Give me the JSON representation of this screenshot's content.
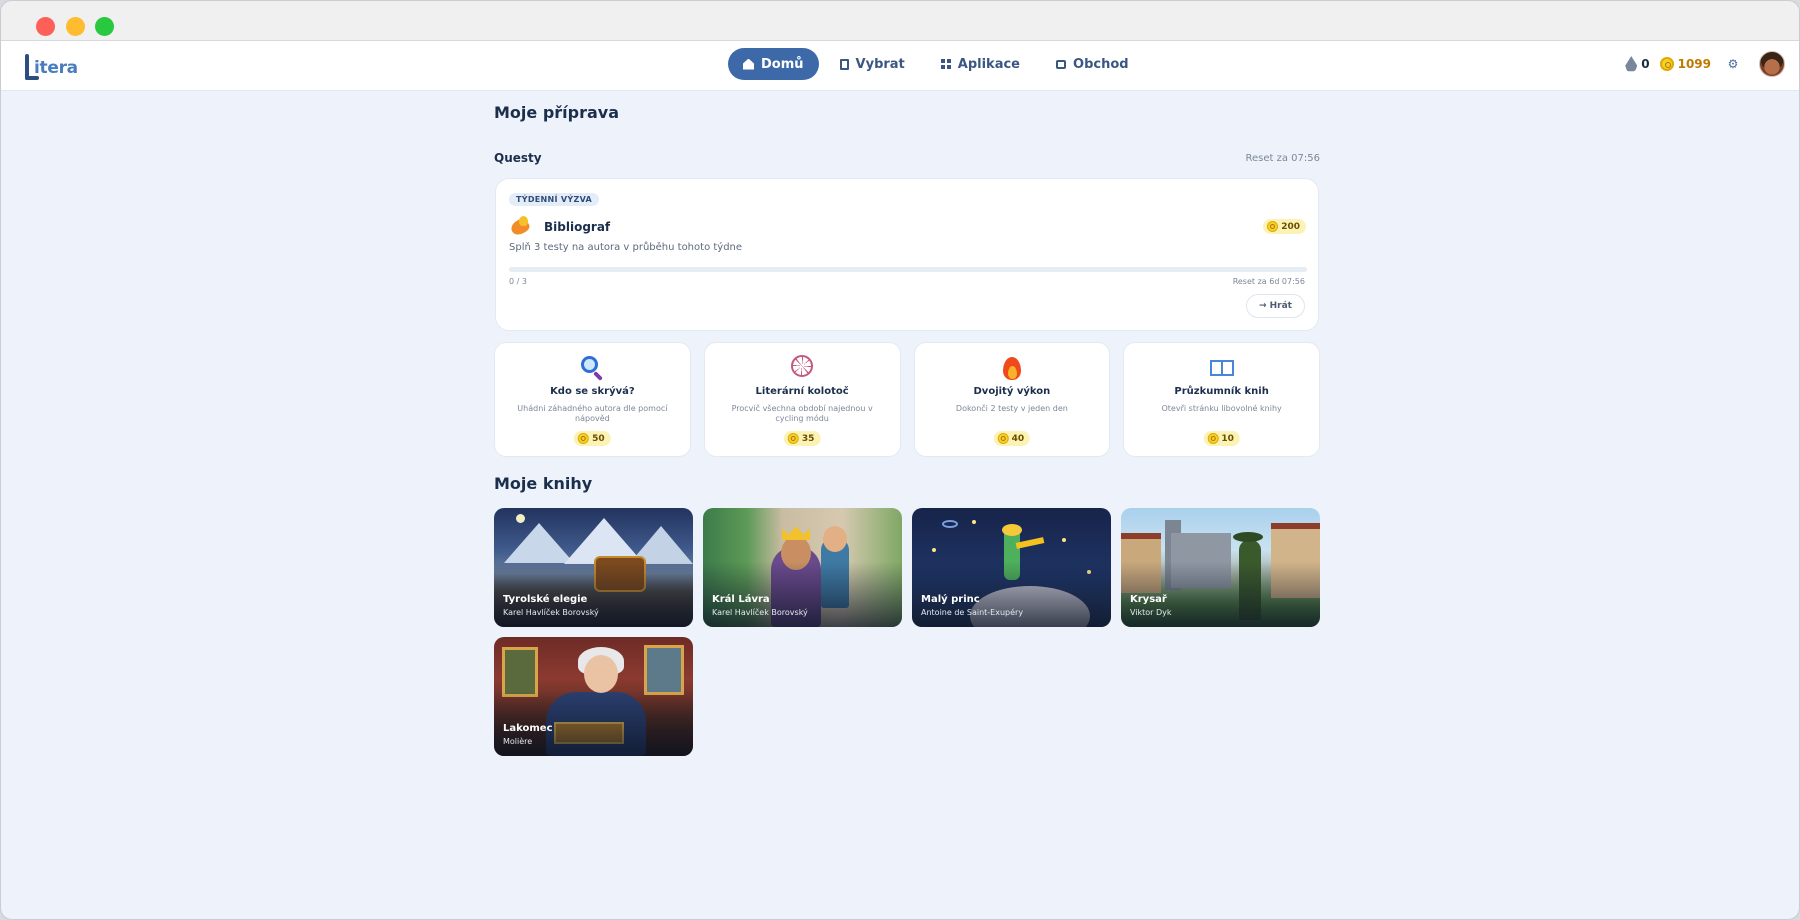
{
  "app": {
    "logo_text": "itera"
  },
  "nav": {
    "items": [
      {
        "label": "Domů",
        "icon": "home-icon",
        "active": true
      },
      {
        "label": "Vybrat",
        "icon": "book-icon",
        "active": false
      },
      {
        "label": "Aplikace",
        "icon": "grid-icon",
        "active": false
      },
      {
        "label": "Obchod",
        "icon": "shop-icon",
        "active": false
      }
    ],
    "streak": "0",
    "coins": "1099",
    "settings_icon": "⚙"
  },
  "page": {
    "title": "Moje příprava"
  },
  "quests": {
    "label": "Questy",
    "reset": "Reset za 07:56",
    "weekly": {
      "tag": "TÝDENNÍ VÝZVA",
      "name": "Bibliograf",
      "description": "Splň 3 testy na autora v průběhu tohoto týdne",
      "reward": "200",
      "progress_text": "0 / 3",
      "progress_fraction": 0,
      "reset": "Reset za 6d 07:56",
      "play_label": "→ Hrát"
    },
    "daily": [
      {
        "name": "Kdo se skrývá?",
        "description": "Uhádni záhadného autora dle pomocí nápověd",
        "reward": "50",
        "icon": "magnifier-icon"
      },
      {
        "name": "Literární kolotoč",
        "description": "Procvič všechna období najednou v cycling módu",
        "reward": "35",
        "icon": "ferris-wheel-icon"
      },
      {
        "name": "Dvojitý výkon",
        "description": "Dokonči 2 testy v jeden den",
        "reward": "40",
        "icon": "fire-icon"
      },
      {
        "name": "Průzkumník knih",
        "description": "Otevři stránku libovolné knihy",
        "reward": "10",
        "icon": "open-book-icon"
      }
    ]
  },
  "books": {
    "title": "Moje knihy",
    "items": [
      {
        "title": "Tyrolské elegie",
        "author": "Karel Havlíček Borovský"
      },
      {
        "title": "Král Lávra",
        "author": "Karel Havlíček Borovský"
      },
      {
        "title": "Malý princ",
        "author": "Antoine de Saint-Exupéry"
      },
      {
        "title": "Krysař",
        "author": "Viktor Dyk"
      },
      {
        "title": "Lakomec",
        "author": "Molière"
      }
    ]
  },
  "colors": {
    "accent": "#3e69a8",
    "background": "#eef3fb",
    "coin": "#f5d12a"
  }
}
